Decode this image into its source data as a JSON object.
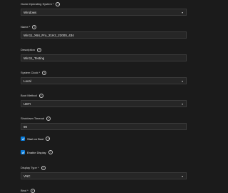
{
  "form": {
    "guest_os": {
      "label": "Guest Operating System *",
      "value": "Windows"
    },
    "name": {
      "label": "Name *",
      "value": "Win11_X64_Pro_21H2_22000_434"
    },
    "description": {
      "label": "Description",
      "value": "Win11_Testing"
    },
    "system_clock": {
      "label": "System Clock *",
      "value": "Local"
    },
    "boot_method": {
      "label": "Boot Method",
      "value": "UEFI"
    },
    "shutdown_timeout": {
      "label": "Shutdown Timeout",
      "value": "90"
    },
    "start_on_boot": {
      "label": "Start on Boot",
      "checked": true
    },
    "enable_display": {
      "label": "Enable Display",
      "checked": true
    },
    "display_type": {
      "label": "Display Type *",
      "value": "VNC"
    },
    "bind": {
      "label": "Bind *"
    }
  },
  "icons": {
    "help": "question-circle-icon",
    "dropdown": "chevron-down-icon",
    "check": "checkmark-icon"
  },
  "colors": {
    "background": "#1b1b1b",
    "input_background": "#262626",
    "checkbox_accent": "#0a7bd8"
  }
}
